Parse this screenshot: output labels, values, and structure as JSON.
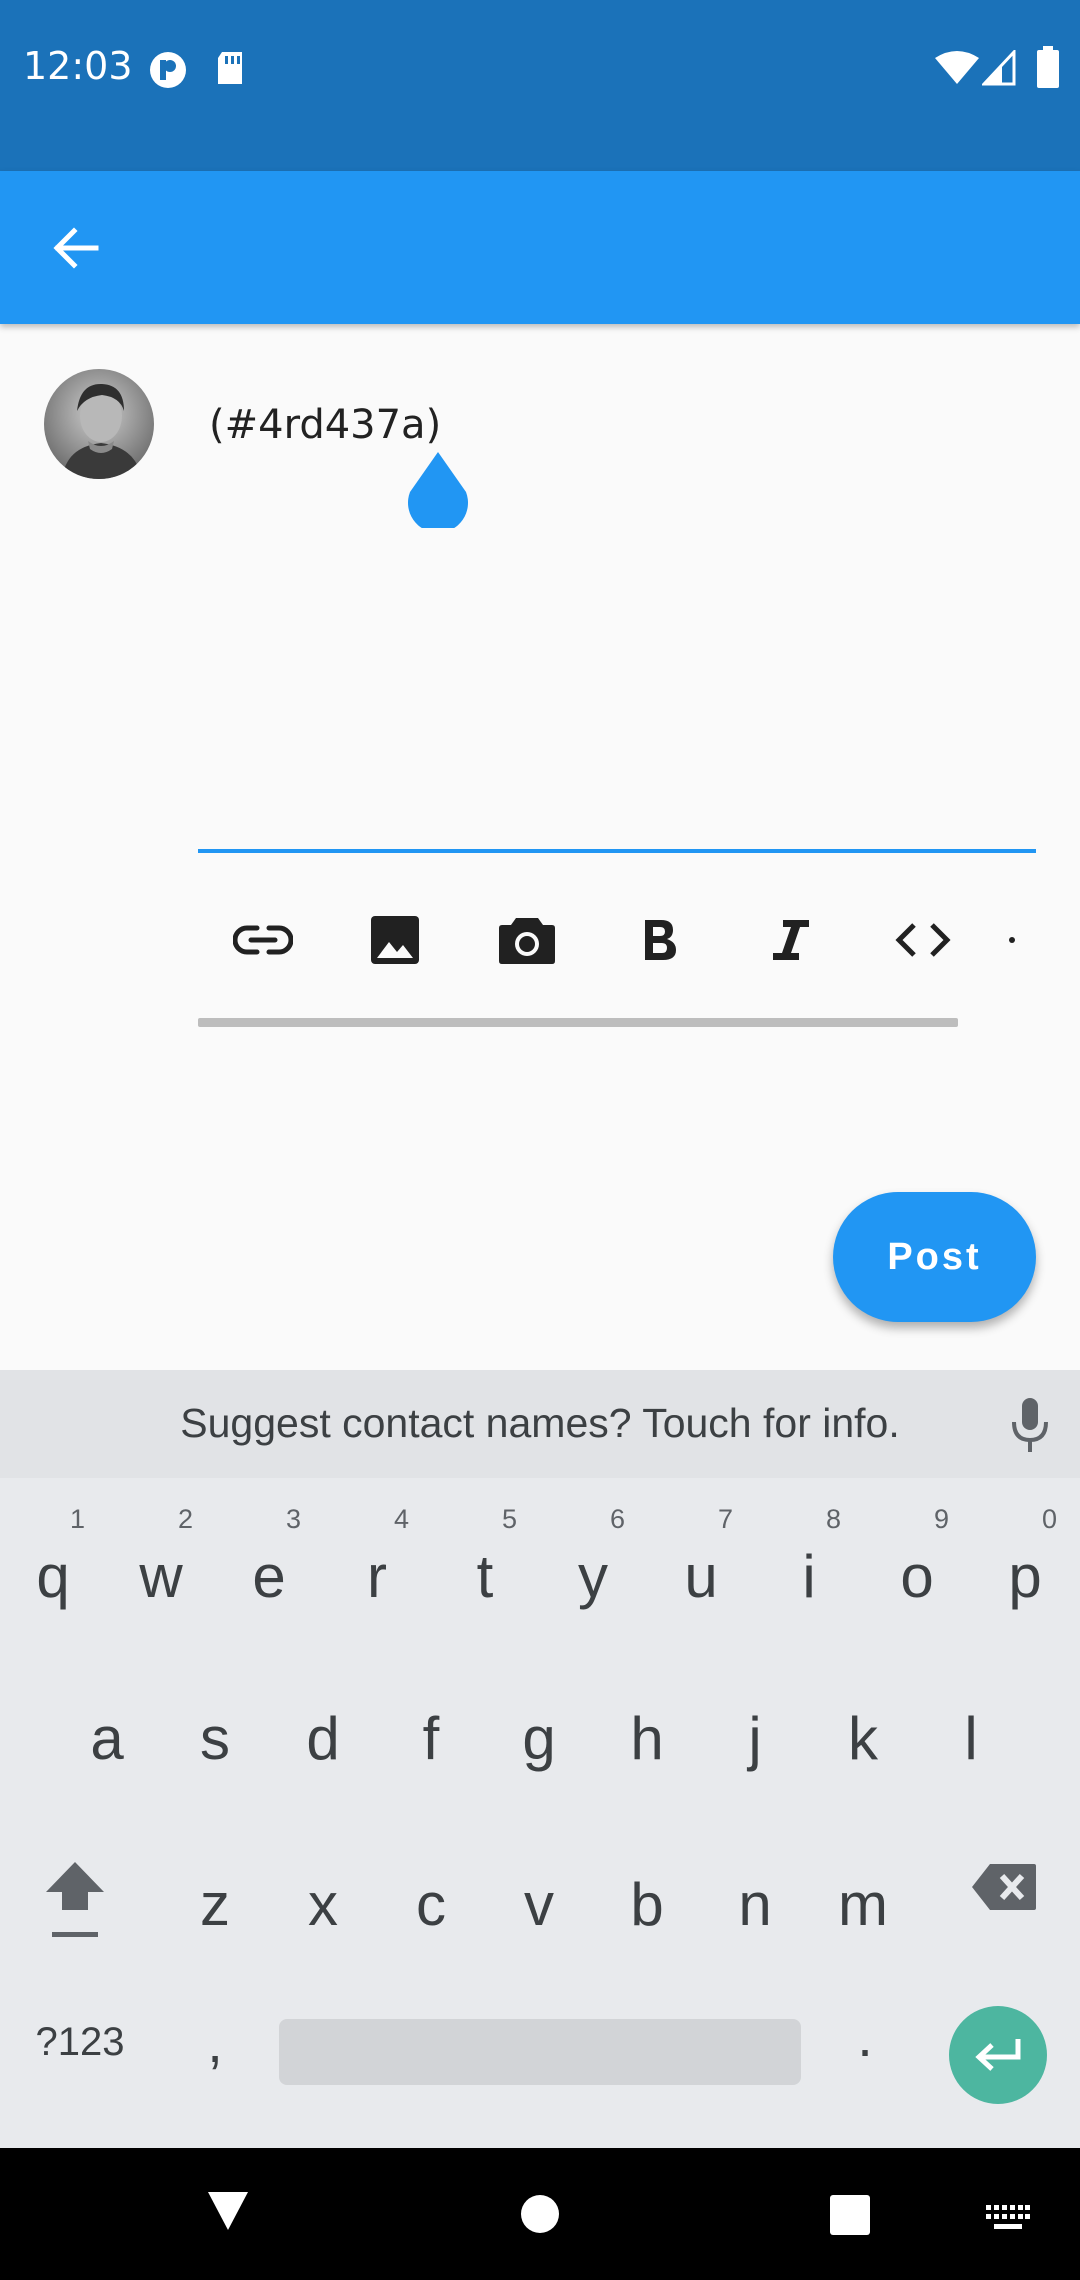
{
  "status_bar": {
    "time": "12:03"
  },
  "compose": {
    "text": "(#4rd437a)"
  },
  "toolbar": {
    "items": [
      "link-icon",
      "image-icon",
      "camera-icon",
      "bold-icon",
      "italic-icon",
      "code-icon",
      "more-icon"
    ]
  },
  "post_button": {
    "label": "Post"
  },
  "keyboard": {
    "suggestion": "Suggest contact names? Touch for info.",
    "row1": [
      {
        "key": "q",
        "hint": "1"
      },
      {
        "key": "w",
        "hint": "2"
      },
      {
        "key": "e",
        "hint": "3"
      },
      {
        "key": "r",
        "hint": "4"
      },
      {
        "key": "t",
        "hint": "5"
      },
      {
        "key": "y",
        "hint": "6"
      },
      {
        "key": "u",
        "hint": "7"
      },
      {
        "key": "i",
        "hint": "8"
      },
      {
        "key": "o",
        "hint": "9"
      },
      {
        "key": "p",
        "hint": "0"
      }
    ],
    "row2": [
      "a",
      "s",
      "d",
      "f",
      "g",
      "h",
      "j",
      "k",
      "l"
    ],
    "row3": [
      "z",
      "x",
      "c",
      "v",
      "b",
      "n",
      "m"
    ],
    "symbols_label": "?123",
    "comma": ",",
    "period": "."
  },
  "colors": {
    "primary": "#2196f3",
    "status_bar": "#1b72b9",
    "enter_key": "#4db6a0"
  }
}
